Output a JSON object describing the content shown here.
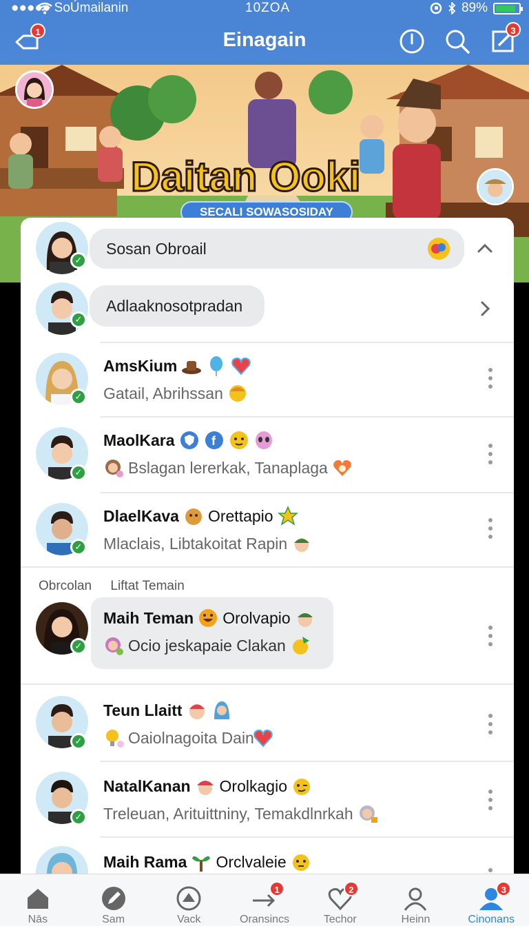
{
  "status_bar": {
    "carrier": "●●●●● SoÚmailanin",
    "time": "10ZOA",
    "battery": "89%",
    "battery_level": 0.89
  },
  "header": {
    "title": "Einagain",
    "back_badge": "1",
    "compose_badge": "3"
  },
  "banner": {
    "title": "Daitan Ooki",
    "subtitle": "SECALI SOWASOSIDAY"
  },
  "top_items": [
    {
      "text": "Sosan Obroail"
    },
    {
      "text": "Adlaaknosotpradan"
    }
  ],
  "contacts": [
    {
      "name": "AmsKium",
      "extra": "",
      "subtitle": "Gatail, Abrihssan"
    },
    {
      "name": "MaolKara",
      "extra": "",
      "subtitle": "Bslagan lererkak, Tanaplaga"
    },
    {
      "name": "DlaelKava",
      "extra": "Orettapio",
      "subtitle": "Mlaclais, Libtakoitat Rapin"
    }
  ],
  "section": {
    "label_1": "Obrcolan",
    "label_2": "Liftat Temain"
  },
  "highlighted": {
    "name": "Maih Teman",
    "extra": "Orolvapio",
    "subtitle": "Ocio jeskapaie Clakan"
  },
  "contacts_2": [
    {
      "name": "Teun Llaitt",
      "extra": "",
      "subtitle": "Oaiolnagoita Dain"
    },
    {
      "name": "NatalKanan",
      "extra": "Orolkagio",
      "subtitle": "Treleuan, Arituittniny, Temakdlnrkah"
    },
    {
      "name": "Maih Rama",
      "extra": "Orclvaleie",
      "subtitle": ""
    }
  ],
  "tabs": [
    {
      "label": "Nās",
      "badge": ""
    },
    {
      "label": "Sam",
      "badge": ""
    },
    {
      "label": "Vack",
      "badge": ""
    },
    {
      "label": "Oransincs",
      "badge": "1"
    },
    {
      "label": "Techor",
      "badge": "2"
    },
    {
      "label": "Heinn",
      "badge": ""
    },
    {
      "label": "Cinonans",
      "badge": "3"
    }
  ],
  "colors": {
    "header": "#4a84d4",
    "accent": "#2f86e0",
    "badge": "#e53935",
    "online": "#2ea043"
  }
}
